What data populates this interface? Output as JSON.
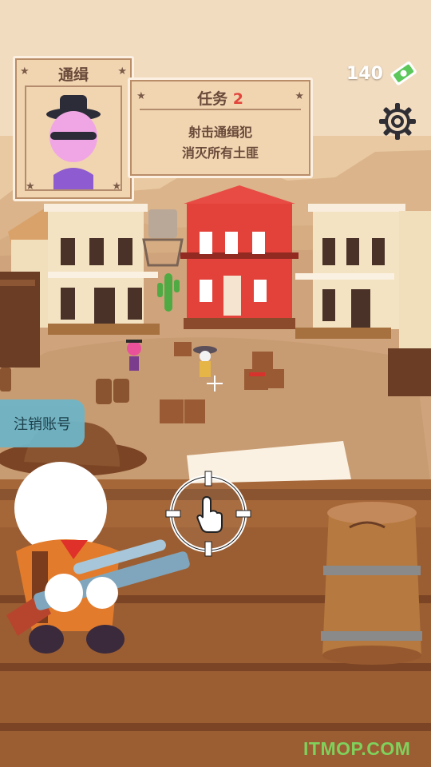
{
  "wanted_poster": {
    "title": "通缉"
  },
  "mission": {
    "label": "任务",
    "number": "2",
    "line1": "射击通缉犯",
    "line2": "消灭所有土匪"
  },
  "hud": {
    "cash": "140"
  },
  "account_button": {
    "label": "注销账号"
  },
  "watermark": "ITMOP.COM",
  "icons": {
    "cash": "cash-stack-icon",
    "settings": "gear-icon",
    "aim": "crosshair-icon",
    "scope": "scope-reticle-icon",
    "pointer": "tap-hand-icon"
  },
  "colors": {
    "panel": "#f1d5b1",
    "panel_text": "#6a4a3a",
    "mission_number": "#e2453c",
    "account_button": "#6fb4c6",
    "cash_green": "#5cc75a"
  }
}
